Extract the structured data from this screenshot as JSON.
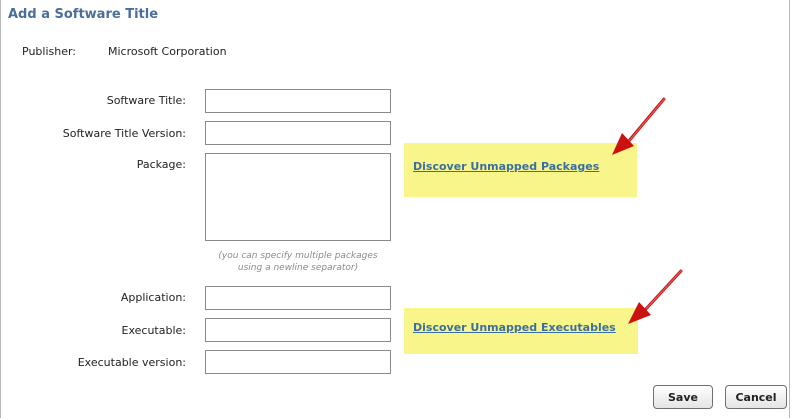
{
  "dialog": {
    "title": "Add a Software Title",
    "publisher_label": "Publisher:",
    "publisher_value": "Microsoft Corporation"
  },
  "form": {
    "software_title_label": "Software Title:",
    "software_title_value": "",
    "version_label": "Software Title Version:",
    "version_value": "",
    "package_label": "Package:",
    "package_value": "",
    "package_hint_line1": "(you can specify multiple packages",
    "package_hint_line2": "using a newline separator)",
    "application_label": "Application:",
    "application_value": "",
    "executable_label": "Executable:",
    "executable_value": "",
    "executable_version_label": "Executable version:",
    "executable_version_value": ""
  },
  "links": {
    "discover_packages": "Discover Unmapped Packages",
    "discover_executables": "Discover Unmapped Executables"
  },
  "buttons": {
    "save": "Save",
    "cancel": "Cancel"
  },
  "colors": {
    "title": "#4a6f9b",
    "link": "#3b6ea0",
    "highlight": "#f8f68a",
    "arrow": "#cc1111"
  },
  "icons": {
    "callout_arrow": "red-arrow-icon"
  }
}
